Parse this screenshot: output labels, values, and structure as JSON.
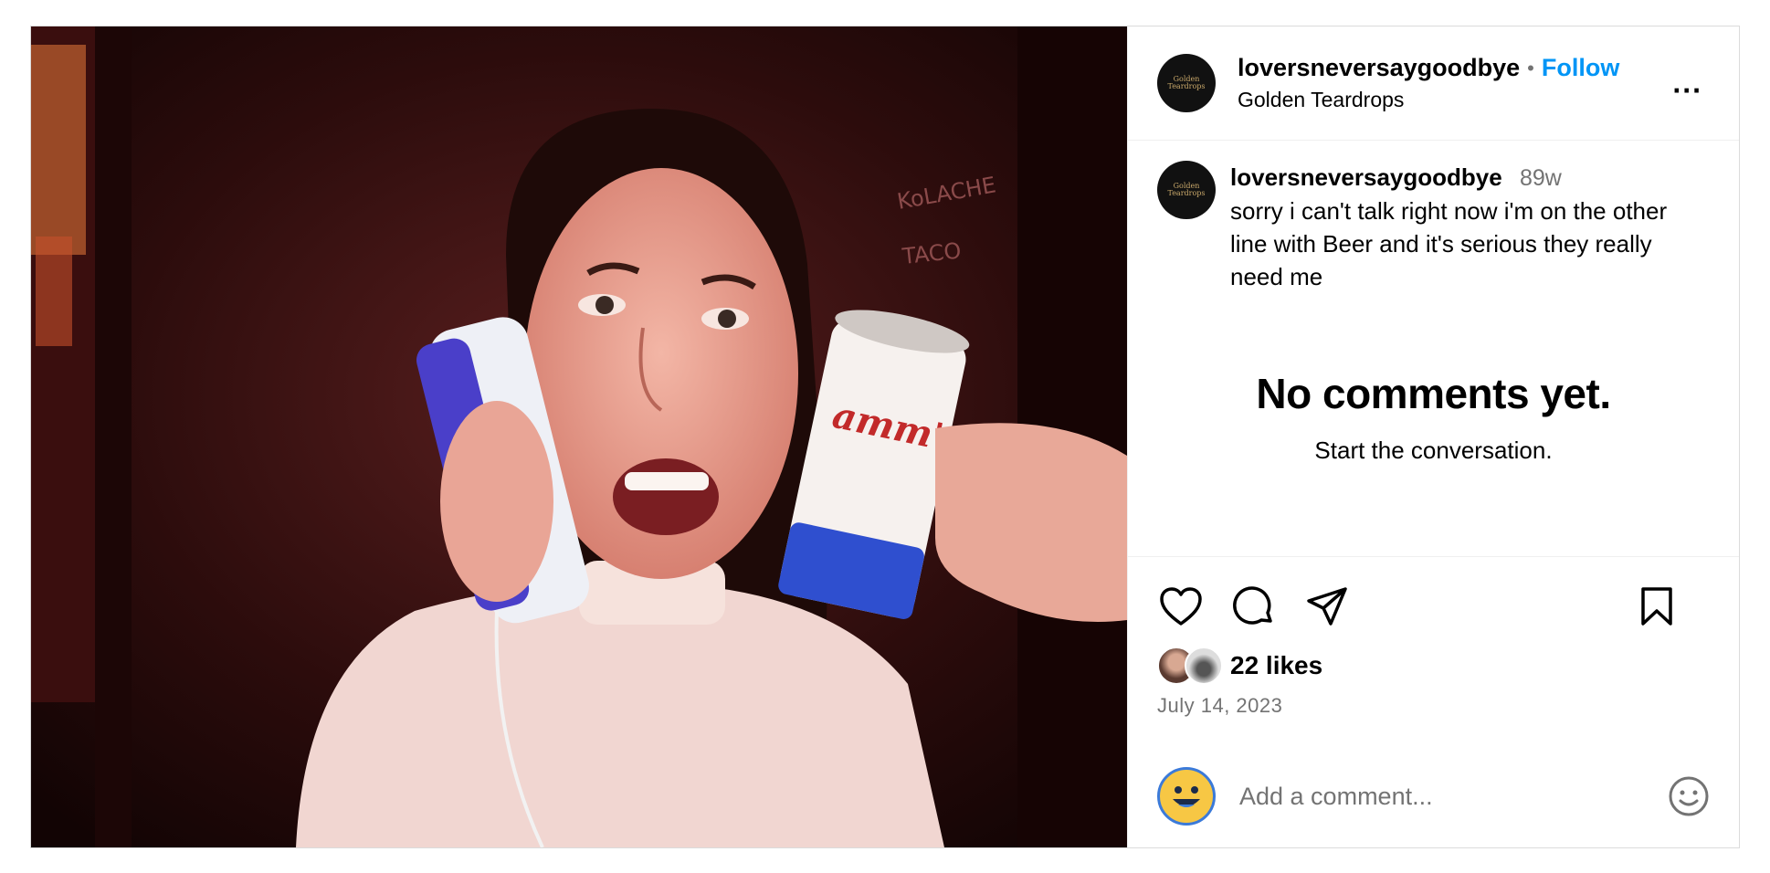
{
  "post": {
    "username": "loversneversaygoodbye",
    "follow_label": "Follow",
    "separator": "•",
    "location": "Golden Teardrops",
    "more_label": "...",
    "avatar_text": "Golden Teardrops"
  },
  "caption": {
    "username": "loversneversaygoodbye",
    "age": "89w",
    "text": "sorry i can't talk right now i'm on the other line with Beer and it's serious they really need me"
  },
  "comments": {
    "empty_title": "No comments yet.",
    "empty_subtitle": "Start the conversation."
  },
  "actions": {
    "icons": [
      "heart-icon",
      "comment-icon",
      "share-icon",
      "bookmark-icon"
    ],
    "likes": "22 likes",
    "date": "July 14, 2023"
  },
  "comment_box": {
    "placeholder": "Add a comment..."
  },
  "photo_text": {
    "can_brand": "amm's",
    "wall_sign": "KoLACHE",
    "wall_sign2": "TACO"
  },
  "colors": {
    "follow": "#0095f6",
    "muted": "#737373"
  }
}
